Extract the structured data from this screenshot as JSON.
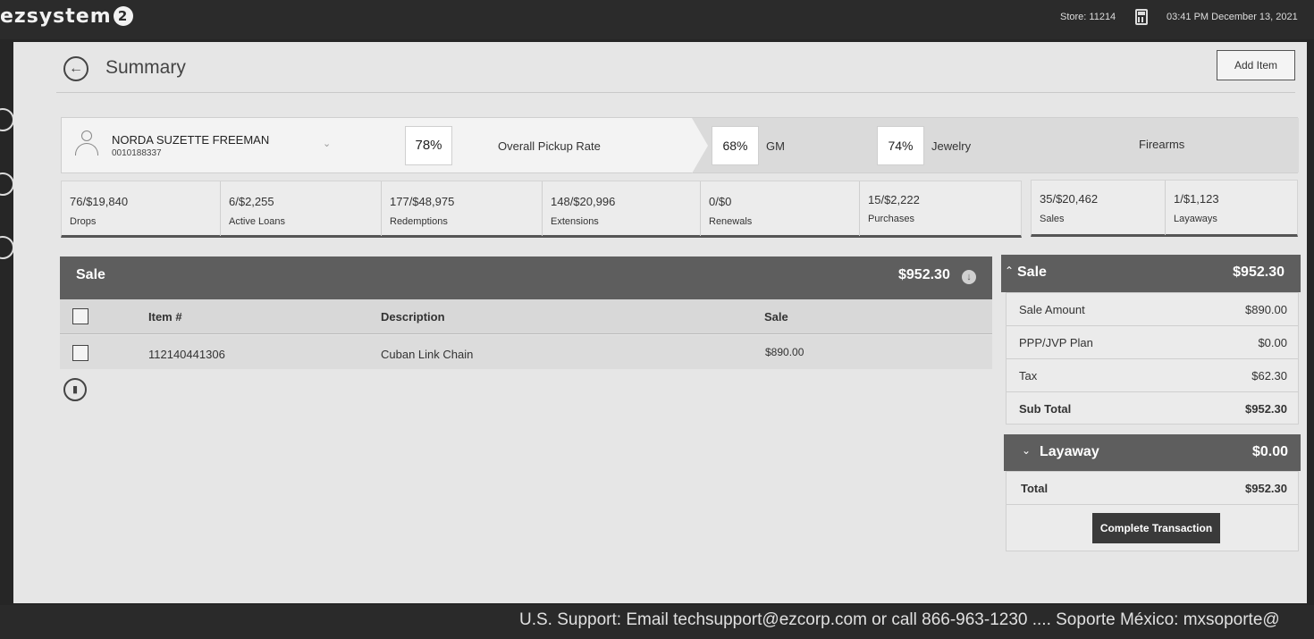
{
  "app": {
    "logo_text": "ezsystem",
    "logo_badge": "2",
    "store": "Store: 11214",
    "datetime": "03:41 PM December 13, 2021"
  },
  "page": {
    "title": "Summary",
    "add_item_label": "Add Item"
  },
  "customer": {
    "name": "NORDA SUZETTE FREEMAN",
    "id": "0010188337",
    "overall_pickup_pct": "78%",
    "overall_pickup_label": "Overall Pickup Rate",
    "gm_pct": "68%",
    "gm_label": "GM",
    "jewelry_pct": "74%",
    "jewelry_label": "Jewelry",
    "firearms_label": "Firearms"
  },
  "stats": [
    {
      "value": "76/$19,840",
      "label": "Drops"
    },
    {
      "value": "6/$2,255",
      "label": "Active Loans"
    },
    {
      "value": "177/$48,975",
      "label": "Redemptions"
    },
    {
      "value": "148/$20,996",
      "label": "Extensions"
    },
    {
      "value": "0/$0",
      "label": "Renewals"
    },
    {
      "value": "15/$2,222",
      "label": "Purchases"
    }
  ],
  "stats2": [
    {
      "value": "35/$20,462",
      "label": "Sales"
    },
    {
      "value": "1/$1,123",
      "label": "Layaways"
    }
  ],
  "sale_table": {
    "title": "Sale",
    "total": "$952.30",
    "columns": {
      "item": "Item #",
      "description": "Description",
      "sale": "Sale"
    },
    "rows": [
      {
        "item": "112140441306",
        "description": "Cuban Link Chain",
        "sale": "$890.00"
      }
    ]
  },
  "summary": {
    "sale_title": "Sale",
    "sale_total": "$952.30",
    "lines": [
      {
        "label": "Sale Amount",
        "value": "$890.00"
      },
      {
        "label": "PPP/JVP Plan",
        "value": "$0.00"
      },
      {
        "label": "Tax",
        "value": "$62.30"
      },
      {
        "label": "Sub Total",
        "value": "$952.30"
      }
    ],
    "layaway_title": "Layaway",
    "layaway_total": "$0.00",
    "total_label": "Total",
    "total_value": "$952.30",
    "complete_label": "Complete Transaction"
  },
  "footer": {
    "text": "U.S. Support: Email techsupport@ezcorp.com or call 866-963-1230 .... Soporte México: mxsoporte@"
  },
  "icons": {
    "back": "back-arrow-icon",
    "user": "user-icon",
    "trash": "trash-icon",
    "calculator": "calculator-icon",
    "download": "download-icon"
  }
}
